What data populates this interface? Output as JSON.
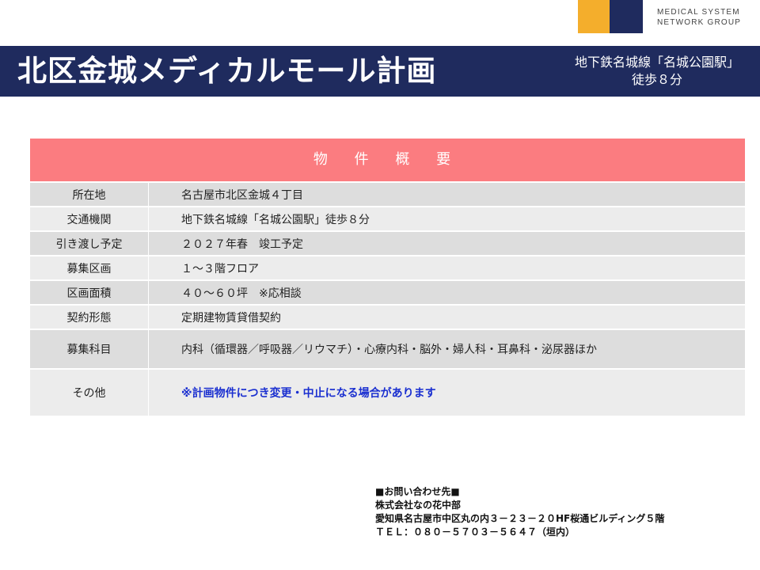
{
  "logo": {
    "line1": "MEDICAL SYSTEM",
    "line2": "NETWORK GROUP"
  },
  "header": {
    "title": "北区金城メディカルモール計画",
    "station_line1": "地下鉄名城線「名城公園駅」",
    "station_line2": "徒歩８分"
  },
  "overview": {
    "heading": "物 件 概 要",
    "rows": [
      {
        "label": "所在地",
        "value": "名古屋市北区金城４丁目"
      },
      {
        "label": "交通機関",
        "value": "地下鉄名城線「名城公園駅」徒歩８分"
      },
      {
        "label": "引き渡し予定",
        "value": "２０２７年春　竣工予定"
      },
      {
        "label": "募集区画",
        "value": "１～３階フロア"
      },
      {
        "label": "区画面積",
        "value": "４０～６０坪　※応相談"
      },
      {
        "label": "契約形態",
        "value": "定期建物賃貸借契約"
      },
      {
        "label": "募集科目",
        "value": "内科（循環器／呼吸器／リウマチ）・心療内科・脳外・婦人科・耳鼻科・泌尿器ほか"
      },
      {
        "label": "その他",
        "value": "※計画物件につき変更・中止になる場合があります"
      }
    ]
  },
  "contact": {
    "heading": "■お問い合わせ先■",
    "company": "株式会社なの花中部",
    "address": "愛知県名古屋市中区丸の内３－２３－２０HF桜通ビルディング５階",
    "tel": "ＴＥＬ：０８０－５７０３－５６４７（垣内）"
  },
  "colors": {
    "navy": "#1f2b5e",
    "orange": "#f4ae2c",
    "pink_header": "#fb7c80",
    "note_blue": "#1a2fd0"
  }
}
